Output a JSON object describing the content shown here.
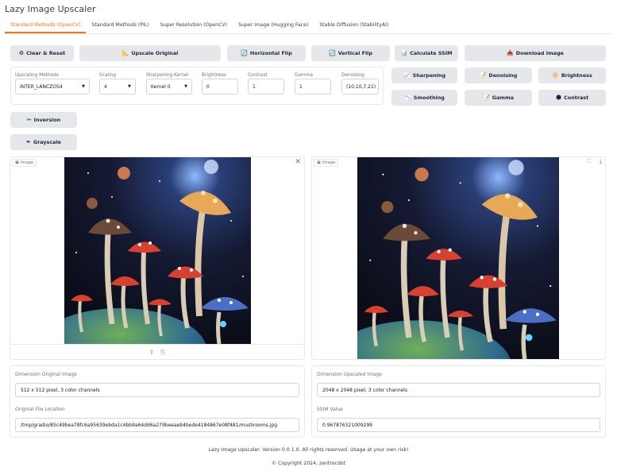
{
  "app": {
    "title": "Lazy Image Upscaler"
  },
  "tabs": [
    {
      "label": "Standard Methods (OpenCV)",
      "active": true
    },
    {
      "label": "Standard Methods (PIL)"
    },
    {
      "label": "Super Resolution (OpenCV)"
    },
    {
      "label": "Super Image (Hugging Face)"
    },
    {
      "label": "Stable Diffusion (StabilityAI)"
    }
  ],
  "toolbar": {
    "clear_reset": {
      "icon": "♻",
      "label": "Clear & Reset"
    },
    "upscale_original": {
      "icon": "📐",
      "label": "Upscale Original"
    },
    "horizontal_flip": {
      "icon": "🔄",
      "label": "Horizontal Flip"
    },
    "vertical_flip": {
      "icon": "🔃",
      "label": "Vertical Flip"
    },
    "calculate_ssim": {
      "icon": "📊",
      "label": "Calculate SSIM"
    },
    "download_image": {
      "icon": "📥",
      "label": "Download Image"
    }
  },
  "controls": {
    "upscaling_methods": {
      "label": "Upscaling Methods",
      "value": "INTER_LANCZOS4"
    },
    "scaling": {
      "label": "Scaling",
      "value": "4"
    },
    "sharpening_kernel": {
      "label": "Sharpening Kernel",
      "value": "Kernel 0"
    },
    "brightness": {
      "label": "Brightness",
      "value": "0"
    },
    "contrast": {
      "label": "Contrast",
      "value": "1"
    },
    "gamma": {
      "label": "Gamma",
      "value": "1"
    },
    "denoising": {
      "label": "Denoising",
      "value": "(10,10,7,21)"
    }
  },
  "effects": {
    "sharpening": {
      "icon": "📈",
      "label": "Sharpening"
    },
    "denoising": {
      "icon": "📝",
      "label": "Denoising"
    },
    "brightness": {
      "icon": "🔆",
      "label": "Brightness"
    },
    "smoothing": {
      "icon": "📉",
      "label": "Smoothing"
    },
    "gamma": {
      "icon": "📝",
      "label": "Gamma"
    },
    "contrast": {
      "icon": "🌑",
      "label": "Contrast"
    },
    "inversion": {
      "icon": "✏",
      "label": "Inversion"
    },
    "grayscale": {
      "icon": "✒",
      "label": "Grayscale"
    }
  },
  "images": {
    "original_label": "Image",
    "upscaled_label": "Image"
  },
  "info": {
    "dimension_original_label": "Dimension Original Image",
    "dimension_original_value": "512 x 512 pixel, 3 color channels",
    "file_location_label": "Original File Location",
    "file_location_value": "/tmp/gradio/85c49bea78fc6a95639ebda1c4bb9a64dd6a279beeaeb4bede4184867e08f481/mushrooms.jpg",
    "dimension_upscaled_label": "Dimension Upscaled Image",
    "dimension_upscaled_value": "2048 x 2048 pixel, 3 color channels",
    "ssim_label": "SSIM Value",
    "ssim_value": "0.967876321009299"
  },
  "footer": {
    "line1": "Lazy Image Upscaler. Version 0.0.1.0. All rights reserved. Usage at your own risk!",
    "line2": "© Copyright 2024, zentrocdot"
  }
}
